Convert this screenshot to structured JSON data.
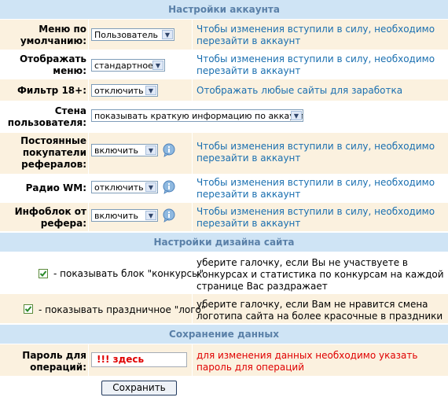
{
  "colors": {
    "section_bg": "#cfe4f5",
    "section_text": "#5a80a8",
    "row_alt": "#fbf1df",
    "hint": "#1a6fb0",
    "warning": "#e00000"
  },
  "account": {
    "title": "Настройки аккаунта",
    "default_menu": {
      "label": "Меню по умолчанию:",
      "value": "Пользователь",
      "hint": "Чтобы изменения вступили в силу, необходимо перезайти в аккаунт"
    },
    "display_menu": {
      "label": "Отображать меню:",
      "value": "стандартное",
      "hint": "Чтобы изменения вступили в силу, необходимо перезайти в аккаунт"
    },
    "filter18": {
      "label": "Фильтр 18+:",
      "value": "отключить",
      "hint": "Отображать любые сайты для заработка"
    },
    "user_wall": {
      "label": "Стена пользователя:",
      "value": "показывать краткую информацию по аккаунту"
    },
    "buyers": {
      "label": "Постоянные покупатели рефералов:",
      "value": "включить",
      "hint": "Чтобы изменения вступили в силу, необходимо перезайти в аккаунт"
    },
    "radio": {
      "label": "Радио WM:",
      "value": "отключить",
      "hint": "Чтобы изменения вступили в силу, необходимо перезайти в аккаунт"
    },
    "infoblock": {
      "label": "Инфоблок от рефера:",
      "value": "включить",
      "hint": "Чтобы изменения вступили в силу, необходимо перезайти в аккаунт"
    }
  },
  "design": {
    "title": "Настройки дизайна сайта",
    "contests": {
      "label": "- показывать блок \"конкурсы\"",
      "checked": true,
      "hint": "уберите галочку, если Вы не участвуете в конкурсах и статистика по конкурсам на каждой странице Вас раздражает"
    },
    "logo": {
      "label": "- показывать праздничное \"лого\"",
      "checked": true,
      "hint": "уберите галочку, если Вам не нравится смена логотипа сайта на более красочные в праздники"
    }
  },
  "save": {
    "title": "Сохранение данных",
    "password": {
      "label": "Пароль для операций:",
      "value": "!!! здесь",
      "hint": "для изменения данных необходимо указать пароль для операций"
    },
    "button": "Сохранить"
  }
}
